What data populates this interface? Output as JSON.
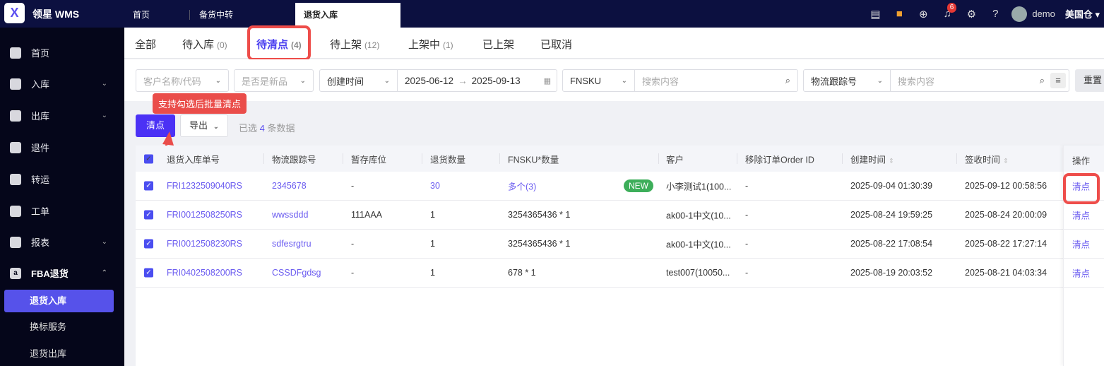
{
  "topbar": {
    "brand": "领星 WMS",
    "tabs": [
      "首页",
      "备货中转",
      "退货入库"
    ],
    "notification_count": "6",
    "user": "demo",
    "warehouse": "美国仓"
  },
  "sidebar": {
    "items": [
      {
        "label": "首页",
        "icon": "home-icon"
      },
      {
        "label": "入库",
        "icon": "inbound-icon",
        "expandable": true
      },
      {
        "label": "出库",
        "icon": "outbound-icon",
        "expandable": true
      },
      {
        "label": "退件",
        "icon": "return-icon"
      },
      {
        "label": "转运",
        "icon": "transfer-icon"
      },
      {
        "label": "工单",
        "icon": "ticket-icon"
      },
      {
        "label": "报表",
        "icon": "report-icon",
        "expandable": true
      },
      {
        "label": "FBA退货",
        "icon": "amazon-icon",
        "expanded": true
      }
    ],
    "subitems": [
      "退货入库",
      "换标服务",
      "退货出库"
    ]
  },
  "status_tabs": [
    {
      "label": "全部",
      "count": ""
    },
    {
      "label": "待入库",
      "count": "(0)"
    },
    {
      "label": "待清点",
      "count": "(4)"
    },
    {
      "label": "待上架",
      "count": "(12)"
    },
    {
      "label": "上架中",
      "count": "(1)"
    },
    {
      "label": "已上架",
      "count": ""
    },
    {
      "label": "已取消",
      "count": ""
    }
  ],
  "filters": {
    "customer_placeholder": "客户名称/代码",
    "is_new_placeholder": "是否是新品",
    "date_type": "创建时间",
    "date_start": "2025-06-12",
    "date_end": "2025-09-13",
    "fnsku_type": "FNSKU",
    "search_placeholder": "搜索内容",
    "tracking_type": "物流跟踪号",
    "search2_placeholder": "搜索内容",
    "reset": "重置"
  },
  "tooltip": "支持勾选后批量清点",
  "actions": {
    "count_button": "清点",
    "export_button": "导出",
    "selected_prefix": "已选",
    "selected_count": "4",
    "selected_suffix": "条数据"
  },
  "table": {
    "headers": [
      "退货入库单号",
      "物流跟踪号",
      "暂存库位",
      "退货数量",
      "FNSKU*数量",
      "客户",
      "移除订单Order ID",
      "创建时间",
      "签收时间",
      "操作"
    ],
    "rows": [
      {
        "no": "FRI1232509040RS",
        "tracking": "2345678",
        "location": "-",
        "qty": "30",
        "fnsku": "多个(3)",
        "new": "NEW",
        "customer": "小李测试1(100...",
        "order_id": "-",
        "created": "2025-09-04 01:30:39",
        "signed": "2025-09-12 00:58:56",
        "action": "清点"
      },
      {
        "no": "FRI0012508250RS",
        "tracking": "wwssddd",
        "location": "111AAA",
        "qty": "1",
        "fnsku": "3254365436 * 1",
        "new": "",
        "customer": "ak00-1中文(10...",
        "order_id": "-",
        "created": "2025-08-24 19:59:25",
        "signed": "2025-08-24 20:00:09",
        "action": "清点"
      },
      {
        "no": "FRI0012508230RS",
        "tracking": "sdfesrgtru",
        "location": "-",
        "qty": "1",
        "fnsku": "3254365436 * 1",
        "new": "",
        "customer": "ak00-1中文(10...",
        "order_id": "-",
        "created": "2025-08-22 17:08:54",
        "signed": "2025-08-22 17:27:14",
        "action": "清点"
      },
      {
        "no": "FRI0402508200RS",
        "tracking": "CSSDFgdsg",
        "location": "-",
        "qty": "1",
        "fnsku": "678 * 1",
        "new": "",
        "customer": "test007(10050...",
        "order_id": "-",
        "created": "2025-08-19 20:03:52",
        "signed": "2025-08-21 04:03:34",
        "action": "清点"
      }
    ]
  }
}
